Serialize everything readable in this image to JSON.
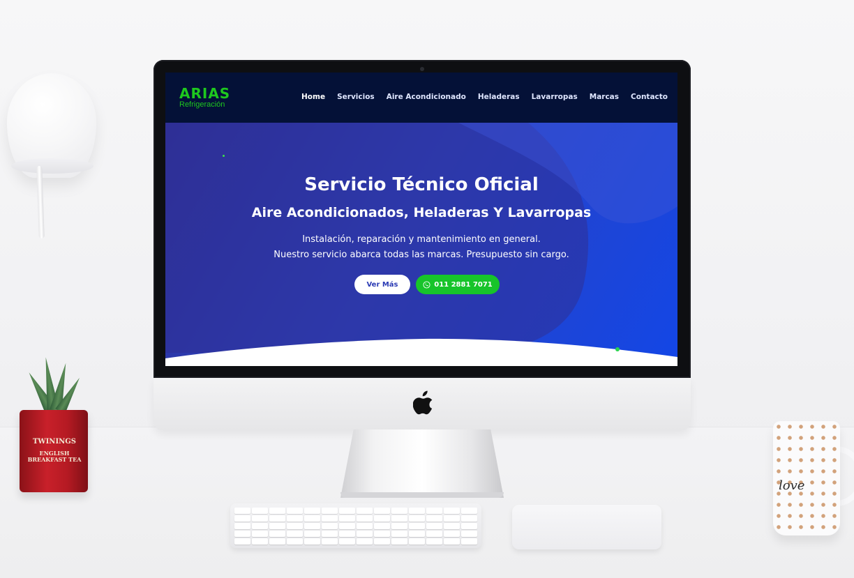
{
  "site": {
    "logo": {
      "title": "ARIAS",
      "subtitle": "Refrigeración"
    },
    "nav": [
      {
        "label": "Home",
        "active": true
      },
      {
        "label": "Servicios"
      },
      {
        "label": "Aire Acondicionado"
      },
      {
        "label": "Heladeras"
      },
      {
        "label": "Lavarropas"
      },
      {
        "label": "Marcas"
      },
      {
        "label": "Contacto"
      }
    ],
    "hero": {
      "title": "Servicio Técnico Oficial",
      "subtitle": "Aire Acondicionados, Heladeras Y Lavarropas",
      "line1": "Instalación, reparación y mantenimiento en general.",
      "line2": "Nuestro servicio abarca todas las marcas. Presupuesto sin cargo.",
      "buttons": {
        "more": "Ver Más",
        "phone": "011 2881 7071"
      }
    },
    "colors": {
      "nav_bg": "#041137",
      "accent_green": "#1EC81E",
      "hero_blue": "#2B3BB4"
    }
  },
  "props": {
    "tin_label": "TWININGS",
    "tin_sublabel": "ENGLISH BREAKFAST TEA",
    "mug_text": "love"
  }
}
